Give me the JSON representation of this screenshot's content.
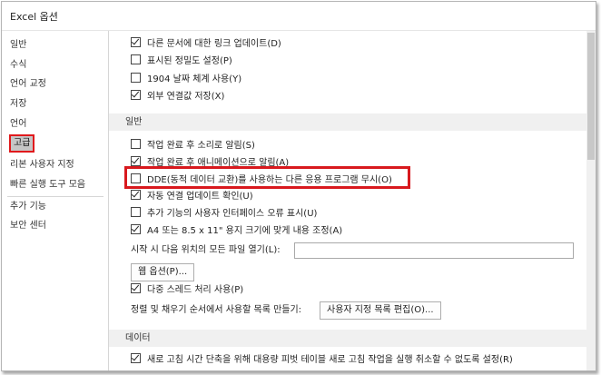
{
  "window": {
    "title": "Excel 옵션"
  },
  "sidebar": {
    "items": [
      {
        "label": "일반"
      },
      {
        "label": "수식"
      },
      {
        "label": "언어 교정"
      },
      {
        "label": "저장"
      },
      {
        "label": "언어"
      },
      {
        "label": "고급",
        "selected": true
      },
      {
        "label": "리본 사용자 지정"
      },
      {
        "label": "빠른 실행 도구 모음"
      },
      {
        "label": "추가 기능"
      },
      {
        "label": "보안 센터"
      }
    ]
  },
  "content": {
    "top_options": [
      {
        "label": "다른 문서에 대한 링크 업데이트(D)",
        "checked": true
      },
      {
        "label": "표시된 정밀도 설정(P)",
        "checked": false
      },
      {
        "label": "1904 날짜 체계 사용(Y)",
        "checked": false
      },
      {
        "label": "외부 연결값 저장(X)",
        "checked": true
      }
    ],
    "general_section": {
      "title": "일반",
      "options": [
        {
          "label": "작업 완료 후 소리로 알림(S)",
          "checked": false
        },
        {
          "label": "작업 완료 후 애니메이션으로 알림(A)",
          "checked": true
        },
        {
          "label": "DDE(동적 데이터 교환)를 사용하는 다른 응용 프로그램 무시(O)",
          "checked": false,
          "highlighted": true
        },
        {
          "label": "자동 연결 업데이트 확인(U)",
          "checked": true
        },
        {
          "label": "추가 기능의 사용자 인터페이스 오류 표시(U)",
          "checked": false
        },
        {
          "label": "A4 또는 8.5 x 11\" 용지 크기에 맞게 내용 조정(A)",
          "checked": true
        }
      ],
      "startup_label": "시작 시 다음 위치의 모든 파일 열기(L):",
      "startup_value": "",
      "web_options_button": "웹 옵션(P)...",
      "multithread": {
        "label": "다중 스레드 처리 사용(P)",
        "checked": true
      },
      "sort_fill_label": "정렬 및 채우기 순서에서 사용할 목록 만들기:",
      "custom_list_button": "사용자 지정 목록 편집(O)..."
    },
    "data_section": {
      "title": "데이터",
      "options": [
        {
          "label": "새로 고침 시간 단축을 위해 대용량 피벗 테이블 새로 고침 작업을 실행 취소할 수 없도록 설정(R)",
          "checked": true
        }
      ]
    }
  },
  "colors": {
    "highlight": "#d8191e",
    "selected_nav_bg": "#c6c6c6",
    "section_bg": "#f0f0f0"
  }
}
